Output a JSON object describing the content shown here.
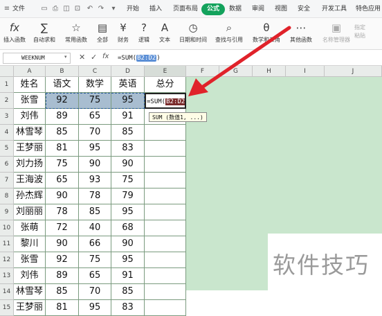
{
  "menu": {
    "file": "文件",
    "tabs": [
      "开始",
      "插入",
      "页面布局",
      "公式",
      "数据",
      "审阅",
      "视图",
      "安全",
      "开发工具",
      "特色应用"
    ],
    "active_tab": "公式"
  },
  "ribbon": {
    "buttons": [
      {
        "label": "插入函数",
        "icon": "fx"
      },
      {
        "label": "自动求和",
        "icon": "∑"
      },
      {
        "label": "常用函数",
        "icon": "☆"
      },
      {
        "label": "全部",
        "icon": "▤"
      },
      {
        "label": "财务",
        "icon": "¥"
      },
      {
        "label": "逻辑",
        "icon": "?"
      },
      {
        "label": "文本",
        "icon": "A"
      },
      {
        "label": "日期和时间",
        "icon": "◷"
      },
      {
        "label": "查找与引用",
        "icon": "⌕"
      },
      {
        "label": "数学和三角",
        "icon": "θ"
      },
      {
        "label": "其他函数",
        "icon": "⋯"
      },
      {
        "label": "名称管理器",
        "icon": "▣"
      },
      {
        "label": "指定",
        "icon": "▦"
      },
      {
        "label": "粘贴",
        "icon": "▧"
      }
    ]
  },
  "formula_bar": {
    "name_box": "WEEKNUM",
    "fx": "fx",
    "formula_prefix": "=SUM(",
    "formula_ref": "B2:D2",
    "formula_suffix": ")"
  },
  "columns": [
    "A",
    "B",
    "C",
    "D",
    "E",
    "F",
    "G",
    "H",
    "I",
    "J"
  ],
  "rows": [
    "1",
    "2",
    "3",
    "4",
    "5",
    "6",
    "7",
    "8",
    "9",
    "10",
    "11",
    "12",
    "13",
    "14",
    "15"
  ],
  "table": {
    "headers": [
      "姓名",
      "语文",
      "数学",
      "英语",
      "总分"
    ],
    "data": [
      [
        "张雪",
        "92",
        "75",
        "95"
      ],
      [
        "刘伟",
        "89",
        "65",
        "91"
      ],
      [
        "林雪琴",
        "85",
        "70",
        "85"
      ],
      [
        "王梦丽",
        "81",
        "95",
        "83"
      ],
      [
        "刘力扬",
        "75",
        "90",
        "90"
      ],
      [
        "王海波",
        "65",
        "93",
        "75"
      ],
      [
        "孙杰辉",
        "90",
        "78",
        "79"
      ],
      [
        "刘丽丽",
        "78",
        "85",
        "95"
      ],
      [
        "张萌",
        "72",
        "40",
        "68"
      ],
      [
        "黎川",
        "90",
        "66",
        "90"
      ],
      [
        "张雪",
        "92",
        "75",
        "95"
      ],
      [
        "刘伟",
        "89",
        "65",
        "91"
      ],
      [
        "林雪琴",
        "85",
        "70",
        "85"
      ],
      [
        "王梦丽",
        "81",
        "95",
        "83"
      ]
    ],
    "editing_cell": {
      "prefix": "=SUM(",
      "ref": "B2:D2",
      "suffix": ")"
    }
  },
  "tooltip": "SUM (数值1, ...)",
  "watermark": "软件技巧",
  "colors": {
    "accent": "#13a25c",
    "grid_bg": "#c9e6cd",
    "selection": "#a8bdd0",
    "arrow": "#e0222a"
  }
}
